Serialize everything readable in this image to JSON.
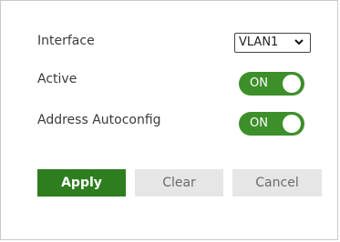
{
  "form": {
    "interface_label": "Interface",
    "interface_value": "VLAN1",
    "active_label": "Active",
    "active_state": "ON",
    "autoconfig_label": "Address Autoconfig",
    "autoconfig_state": "ON"
  },
  "buttons": {
    "apply": "Apply",
    "clear": "Clear",
    "cancel": "Cancel"
  },
  "colors": {
    "toggle_on": "#3d8f2a",
    "apply_bg": "#2e7d1e",
    "secondary_bg": "#e6e6e6"
  },
  "icons": {
    "select_chevron": "chevron-down-icon"
  }
}
